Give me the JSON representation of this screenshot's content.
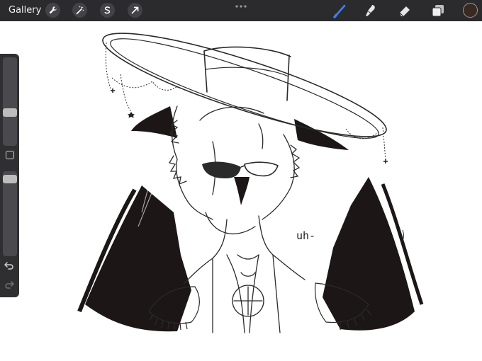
{
  "toolbar": {
    "gallery_label": "Gallery",
    "left_tools": [
      "wrench-icon",
      "magic-wand-icon",
      "selection-icon",
      "transform-arrow-icon"
    ],
    "center_menu": "more-dots-icon",
    "right_tools": [
      "brush-icon",
      "smudge-icon",
      "eraser-icon",
      "layers-icon"
    ],
    "active_tool": "brush-icon",
    "active_color": "#3a2920",
    "accent_color": "#3b82f6"
  },
  "sidebar": {
    "brush_size_level": 0.36,
    "opacity_level": 0.12,
    "icons": [
      "modify-square-icon",
      "undo-icon",
      "redo-icon"
    ]
  },
  "canvas": {
    "handwritten_text": "uh-",
    "background": "#ffffff"
  }
}
